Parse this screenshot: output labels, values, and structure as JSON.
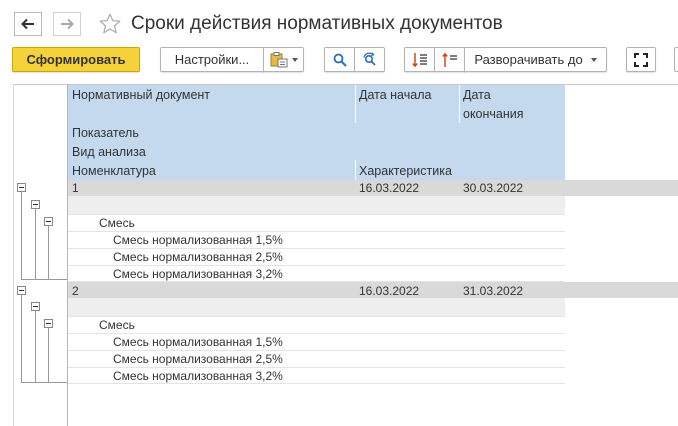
{
  "header": {
    "title": "Сроки действия нормативных документов",
    "back_icon": "arrow-left-icon",
    "forward_icon": "arrow-right-icon",
    "favorite_icon": "star-icon"
  },
  "toolbar": {
    "generate_label": "Сформировать",
    "settings_label": "Настройки...",
    "expand_label": "Разворачивать до",
    "accent_color": "#f5d23a"
  },
  "report": {
    "columns": {
      "doc": "Нормативный документ",
      "start": "Дата начала",
      "end_line1": "Дата",
      "end_line2": "окончания",
      "indicator": "Показатель",
      "analysis": "Вид анализа",
      "nomenclature": "Номенклатура",
      "characteristic": "Характеристика"
    },
    "groups": [
      {
        "number": "1",
        "start": "16.03.2022",
        "end": "30.03.2022",
        "category": "Смесь",
        "items": [
          "Смесь нормализованная 1,5%",
          "Смесь нормализованная 2,5%",
          "Смесь нормализованная 3,2%"
        ]
      },
      {
        "number": "2",
        "start": "16.03.2022",
        "end": "31.03.2022",
        "category": "Смесь",
        "items": [
          "Смесь нормализованная 1,5%",
          "Смесь нормализованная 2,5%",
          "Смесь нормализованная 3,2%"
        ]
      }
    ]
  }
}
